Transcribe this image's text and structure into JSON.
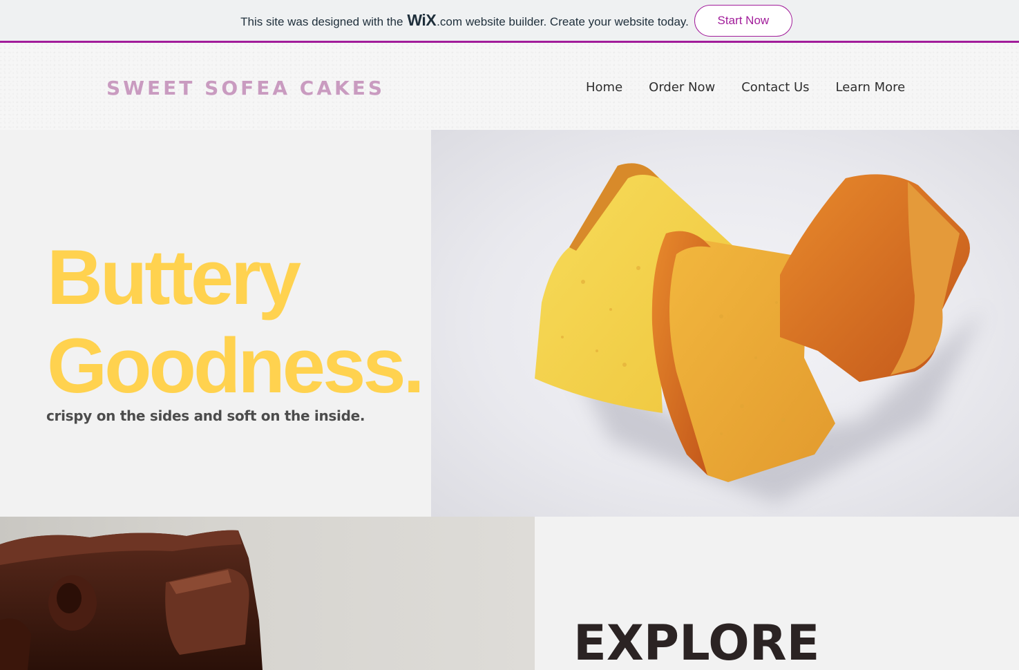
{
  "wix_banner": {
    "text_before": "This site was designed with the",
    "logo": "WiX",
    "dotcom": ".com",
    "text_after": "website builder. Create your website today.",
    "cta": "Start Now",
    "accent_color": "#a11c9a"
  },
  "header": {
    "brand": "SWEET SOFEA CAKES",
    "brand_color": "#c99bc0",
    "nav": [
      {
        "label": "Home"
      },
      {
        "label": "Order Now"
      },
      {
        "label": "Contact Us"
      },
      {
        "label": "Learn More"
      }
    ]
  },
  "hero": {
    "title_line1": "Buttery",
    "title_line2": "Goodness.",
    "subtitle": "crispy on the sides and soft on the inside.",
    "title_color": "#ffd24f",
    "image": "butter-cake-slices-photo"
  },
  "lower": {
    "image": "chocolate-cake-photo",
    "heading": "EXPLORE"
  }
}
